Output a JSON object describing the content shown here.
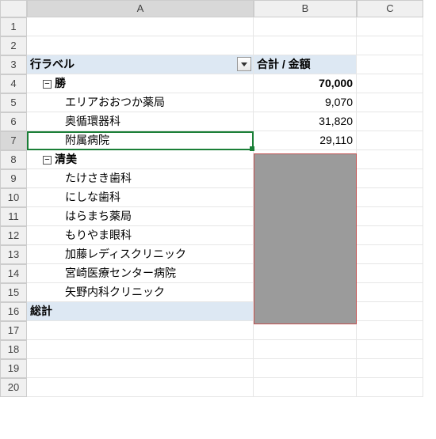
{
  "columns": {
    "A": "A",
    "B": "B",
    "C": "C"
  },
  "row_numbers": [
    "1",
    "2",
    "3",
    "4",
    "5",
    "6",
    "7",
    "8",
    "9",
    "10",
    "11",
    "12",
    "13",
    "14",
    "15",
    "16",
    "17",
    "18",
    "19",
    "20"
  ],
  "pivot": {
    "row_label_header": "行ラベル",
    "value_header": "合計 / 金額",
    "groups": [
      {
        "name": "勝",
        "subtotal": "70,000",
        "items": [
          {
            "label": "エリアおおつか薬局",
            "value": "9,070"
          },
          {
            "label": "奥循環器科",
            "value": "31,820"
          },
          {
            "label": "附属病院",
            "value": "29,110"
          }
        ]
      },
      {
        "name": "清美",
        "subtotal": "",
        "items": [
          {
            "label": "たけさき歯科",
            "value": ""
          },
          {
            "label": "にしな歯科",
            "value": ""
          },
          {
            "label": "はらまち薬局",
            "value": ""
          },
          {
            "label": "もりやま眼科",
            "value": ""
          },
          {
            "label": "加藤レディスクリニック",
            "value": ""
          },
          {
            "label": "宮崎医療センター病院",
            "value": ""
          },
          {
            "label": "矢野内科クリニック",
            "value": ""
          }
        ]
      }
    ],
    "grand_total_label": "総計",
    "grand_total_value": ""
  },
  "active_cell": "A7",
  "chart_data": {
    "type": "table",
    "title": "合計 / 金額 by 行ラベル",
    "columns": [
      "行ラベル",
      "合計 / 金額"
    ],
    "rows": [
      [
        "勝",
        70000
      ],
      [
        "  エリアおおつか薬局",
        9070
      ],
      [
        "  奥循環器科",
        31820
      ],
      [
        "  附属病院",
        29110
      ],
      [
        "清美",
        null
      ],
      [
        "  たけさき歯科",
        null
      ],
      [
        "  にしな歯科",
        null
      ],
      [
        "  はらまち薬局",
        null
      ],
      [
        "  もりやま眼科",
        null
      ],
      [
        "  加藤レディスクリニック",
        null
      ],
      [
        "  宮崎医療センター病院",
        null
      ],
      [
        "  矢野内科クリニック",
        null
      ],
      [
        "総計",
        null
      ]
    ]
  }
}
